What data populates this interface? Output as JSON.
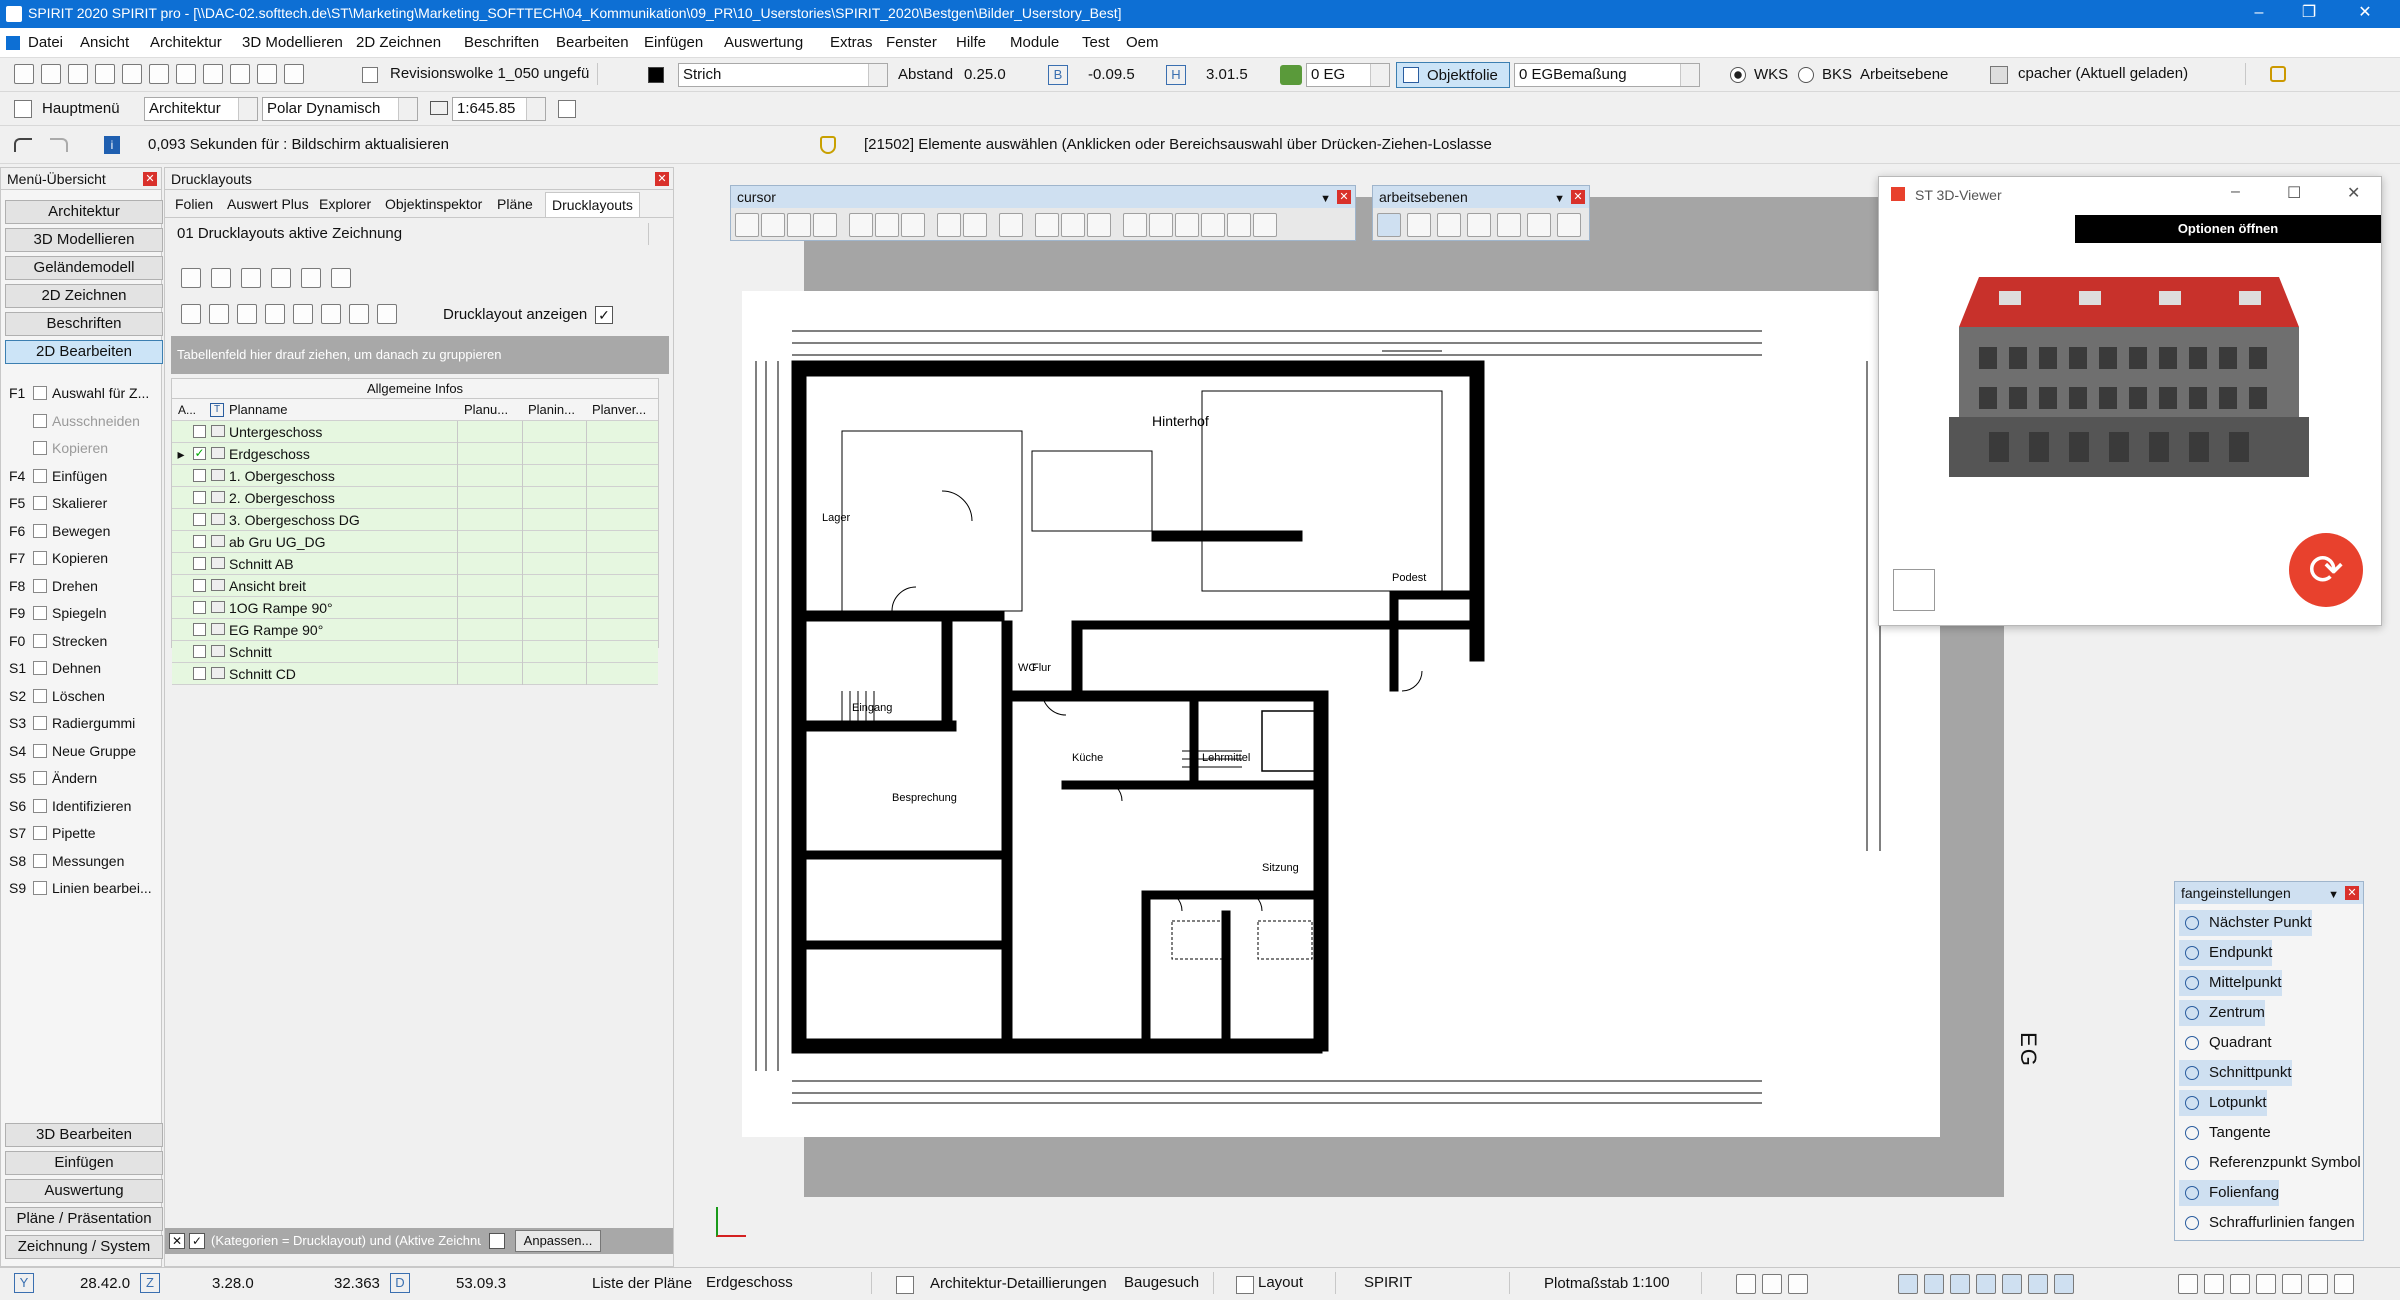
{
  "app": {
    "title": "SPIRIT 2020 SPIRIT pro - [\\\\DAC-02.softtech.de\\ST\\Marketing\\Marketing_SOFTTECH\\04_Kommunikation\\09_PR\\10_Userstories\\SPIRIT_2020\\Bestgen\\Bilder_Userstory_Best]",
    "window_controls": [
      "–",
      "❐",
      "✕"
    ]
  },
  "menu": [
    "Datei",
    "Ansicht",
    "Architektur",
    "3D Modellieren",
    "2D Zeichnen",
    "Beschriften",
    "Bearbeiten",
    "Einfügen",
    "Auswertung",
    "Extras",
    "Fenster",
    "Hilfe",
    "Module",
    "Test",
    "Oem"
  ],
  "toolbar1": {
    "revision": "Revisionswolke 1_050 ungefü",
    "line_style": "Strich",
    "abstand_label": "Abstand",
    "abstand_value": "0.25.0",
    "offset_value": "-0.09.5",
    "h_value": "3.01.5",
    "floor": "0 EG",
    "objektfolie": "Objektfolie",
    "layer": "0 EGBemaßung",
    "wks": "WKS",
    "bks": "BKS",
    "arbeitsebene": "Arbeitsebene",
    "user": "cpacher (Aktuell geladen)"
  },
  "toolbar2": {
    "hauptmenu": "Hauptmenü",
    "architektur": "Architektur",
    "polar": "Polar Dynamisch",
    "scale": "1:645.85"
  },
  "toolbar3": {
    "message": "0,093 Sekunden für : Bildschirm aktualisieren",
    "hint": "[21502] Elemente auswählen (Anklicken oder Bereichsauswahl über Drücken-Ziehen-Loslasse"
  },
  "menu_overview": {
    "title": "Menü-Übersicht",
    "buttons": [
      "Architektur",
      "3D Modellieren",
      "Geländemodell",
      "2D Zeichnen",
      "Beschriften",
      "2D Bearbeiten"
    ],
    "selected": "2D Bearbeiten",
    "functions": [
      {
        "key": "F1",
        "label": "Auswahl für Z..."
      },
      {
        "key": "",
        "label": "Ausschneiden",
        "disabled": true
      },
      {
        "key": "",
        "label": "Kopieren",
        "disabled": true
      },
      {
        "key": "F4",
        "label": "Einfügen"
      },
      {
        "key": "F5",
        "label": "Skalierer"
      },
      {
        "key": "F6",
        "label": "Bewegen"
      },
      {
        "key": "F7",
        "label": "Kopieren"
      },
      {
        "key": "F8",
        "label": "Drehen"
      },
      {
        "key": "F9",
        "label": "Spiegeln"
      },
      {
        "key": "F0",
        "label": "Strecken"
      },
      {
        "key": "S1",
        "label": "Dehnen"
      },
      {
        "key": "S2",
        "label": "Löschen"
      },
      {
        "key": "S3",
        "label": "Radiergummi"
      },
      {
        "key": "S4",
        "label": "Neue Gruppe"
      },
      {
        "key": "S5",
        "label": "Ändern"
      },
      {
        "key": "S6",
        "label": "Identifizieren"
      },
      {
        "key": "S7",
        "label": "Pipette"
      },
      {
        "key": "S8",
        "label": "Messungen"
      },
      {
        "key": "S9",
        "label": "Linien bearbei..."
      }
    ],
    "bottom_buttons": [
      "3D Bearbeiten",
      "Einfügen",
      "Auswertung",
      "Pläne / Präsentation",
      "Zeichnung / System"
    ]
  },
  "drucklayouts": {
    "title": "Drucklayouts",
    "tabs": [
      "Folien",
      "Auswert Plus",
      "Explorer",
      "Objektinspektor",
      "Pläne",
      "Drucklayouts"
    ],
    "active_tab": "Drucklayouts",
    "dropdown": "01 Drucklayouts aktive Zeichnung",
    "show_label": "Drucklayout anzeigen",
    "group_hint": "Tabellenfeld hier drauf ziehen, um danach zu gruppieren",
    "group_header": "Allgemeine Infos",
    "columns": [
      "A...",
      "T",
      "Planname",
      "Planu...",
      "Planin...",
      "Planver..."
    ],
    "rows": [
      {
        "name": "Untergeschoss",
        "checked": false
      },
      {
        "name": "Erdgeschoss",
        "checked": true,
        "current": true
      },
      {
        "name": "1. Obergeschoss",
        "checked": false
      },
      {
        "name": "2. Obergeschoss",
        "checked": false
      },
      {
        "name": "3. Obergeschoss DG",
        "checked": false
      },
      {
        "name": "ab Gru UG_DG",
        "checked": false
      },
      {
        "name": "Schnitt AB",
        "checked": false
      },
      {
        "name": "Ansicht breit",
        "checked": false
      },
      {
        "name": "1OG Rampe 90°",
        "checked": false
      },
      {
        "name": "EG Rampe 90°",
        "checked": false
      },
      {
        "name": "Schnitt",
        "checked": false
      },
      {
        "name": "Schnitt CD",
        "checked": false
      }
    ],
    "filter": "(Kategorien  = Drucklayout) und (Aktive Zeichnung = `",
    "anpassen": "Anpassen..."
  },
  "floating": {
    "cursor_title": "cursor",
    "arbeitsebenen_title": "arbeitsebenen"
  },
  "viewer3d": {
    "title": "ST 3D-Viewer",
    "button": "Optionen öffnen"
  },
  "snap": {
    "title": "fangeinstellungen",
    "items": [
      {
        "label": "Nächster Punkt",
        "on": true
      },
      {
        "label": "Endpunkt",
        "on": true
      },
      {
        "label": "Mittelpunkt",
        "on": true
      },
      {
        "label": "Zentrum",
        "on": true
      },
      {
        "label": "Quadrant",
        "on": false
      },
      {
        "label": "Schnittpunkt",
        "on": true
      },
      {
        "label": "Lotpunkt",
        "on": true
      },
      {
        "label": "Tangente",
        "on": false
      },
      {
        "label": "Referenzpunkt Symbol",
        "on": false
      },
      {
        "label": "Folienfang",
        "on": true
      },
      {
        "label": "Schraffurlinien fangen",
        "on": false
      }
    ]
  },
  "plan": {
    "rooms": [
      "Hinterhof",
      "Küche",
      "Lehrmittel",
      "Eingang",
      "Flur",
      "WC",
      "Lager",
      "Besprechung",
      "Podest",
      "Sitzung"
    ],
    "side_text": "EG"
  },
  "status": {
    "y_label": "Y",
    "y": "28.42.0",
    "z_label": "Z",
    "z": "3.28.0",
    "d": "32.363",
    "d_label": "D",
    "angle": "53.09.3",
    "plan_list_label": "Liste der Pläne",
    "plan": "Erdgeschoss",
    "detail": "Architektur-Detaillierungen",
    "baugesuch": "Baugesuch",
    "layout": "Layout",
    "spirit": "SPIRIT",
    "plotscale_label": "Plotmaßstab",
    "plotscale": "1:100"
  },
  "colors": {
    "accent": "#0d6fd4",
    "selected": "#cce4f7",
    "green_rows": "#e6f7e0",
    "refresh": "#e8412d"
  }
}
